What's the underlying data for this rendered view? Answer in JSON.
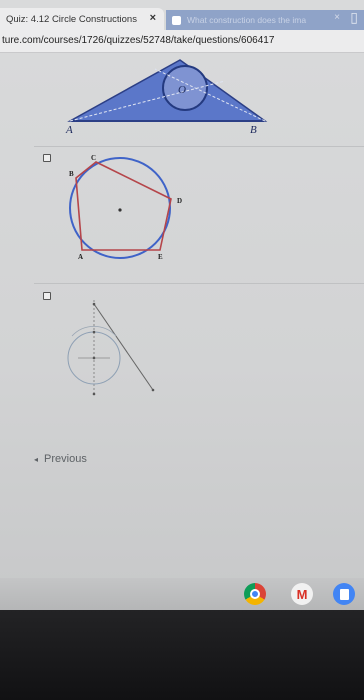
{
  "browser": {
    "active_tab_title": "Quiz: 4.12 Circle Constructions",
    "active_tab_close": "×",
    "inactive_tab_title": "What construction does the ima",
    "inactive_tab_close": "×",
    "url": "ture.com/courses/1726/quizzes/52748/take/questions/606417"
  },
  "figure1": {
    "label_a": "A",
    "label_b": "B",
    "label_o": "O"
  },
  "option1": {
    "label_c": "C",
    "label_b": "B",
    "label_d": "D",
    "label_a": "A",
    "label_e": "E"
  },
  "navigation": {
    "previous_label": "Previous",
    "previous_arrow": "◂"
  },
  "shelf": {
    "icons": [
      "chrome-icon",
      "gmail-icon",
      "docs-icon"
    ]
  },
  "colors": {
    "triangle_fill": "#5b77c9",
    "circle_blue": "#3f63c8",
    "pentagon_red": "#b5454a"
  }
}
